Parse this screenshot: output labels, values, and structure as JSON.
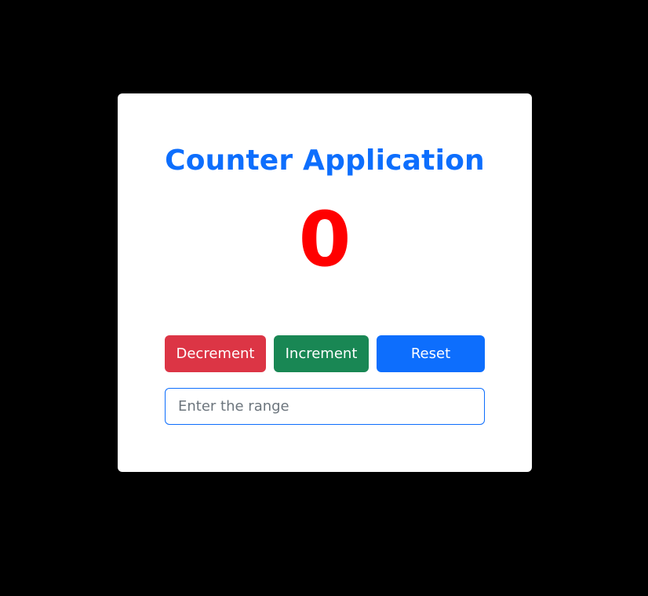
{
  "app": {
    "title": "Counter Application",
    "count": "0"
  },
  "buttons": {
    "decrement_label": "Decrement",
    "increment_label": "Increment",
    "reset_label": "Reset"
  },
  "range_input": {
    "value": "",
    "placeholder": "Enter the range"
  },
  "colors": {
    "page_background": "#000000",
    "card_background": "#ffffff",
    "title": "#0d6efd",
    "count": "#ff0000",
    "decrement": "#dc3545",
    "increment": "#198754",
    "reset": "#0d6efd",
    "input_border": "#0d6efd"
  }
}
